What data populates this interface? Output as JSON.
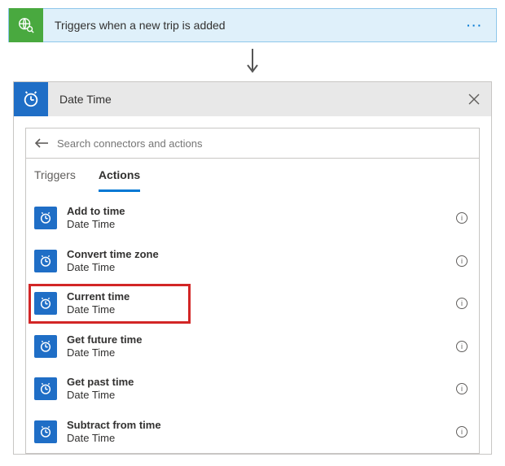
{
  "trigger": {
    "title": "Triggers when a new trip is added"
  },
  "panel": {
    "title": "Date Time",
    "search_placeholder": "Search connectors and actions"
  },
  "tabs": {
    "triggers": "Triggers",
    "actions": "Actions"
  },
  "actions": [
    {
      "title": "Add to time",
      "subtitle": "Date Time"
    },
    {
      "title": "Convert time zone",
      "subtitle": "Date Time"
    },
    {
      "title": "Current time",
      "subtitle": "Date Time"
    },
    {
      "title": "Get future time",
      "subtitle": "Date Time"
    },
    {
      "title": "Get past time",
      "subtitle": "Date Time"
    },
    {
      "title": "Subtract from time",
      "subtitle": "Date Time"
    }
  ],
  "highlight_index": 2
}
